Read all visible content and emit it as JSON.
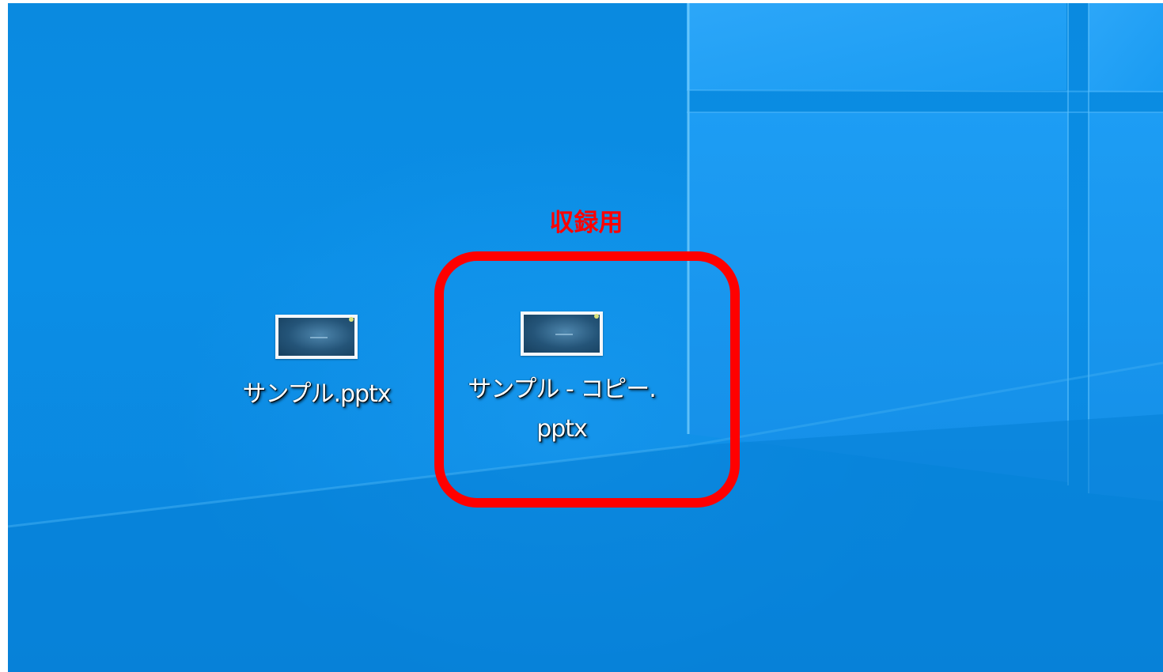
{
  "desktop": {
    "icons": [
      {
        "label_lines": [
          "サンプル.pptx"
        ],
        "icon": "pptx-file-icon"
      },
      {
        "label_lines": [
          "サンプル - コピー.",
          "pptx"
        ],
        "icon": "pptx-file-icon"
      }
    ]
  },
  "annotation": {
    "text": "収録用",
    "color": "#ff0000"
  },
  "colors": {
    "desktop_blue": "#0a8ae0",
    "highlight_red": "#ff0000"
  }
}
